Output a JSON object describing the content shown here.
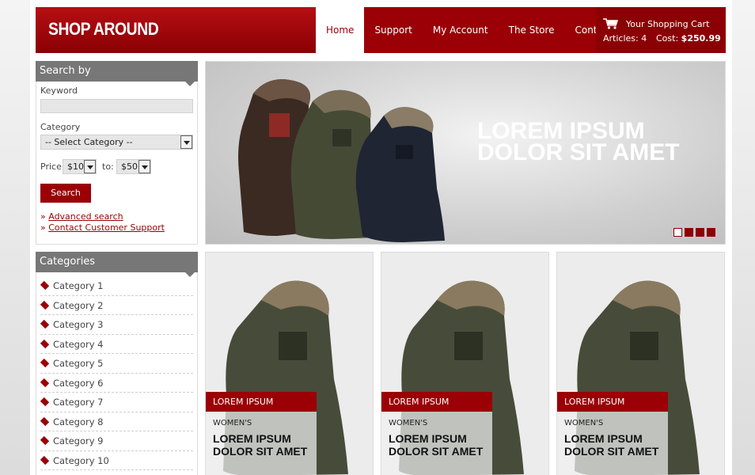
{
  "header": {
    "logo": "SHOP AROUND",
    "nav": [
      "Home",
      "Support",
      "My Account",
      "The Store",
      "Contact"
    ],
    "active_nav": "Home",
    "cart": {
      "title": "Your Shopping Cart",
      "articles_label": "Articles: 4",
      "cost_label": "Cost:",
      "cost_value": "$250.99"
    }
  },
  "search": {
    "heading": "Search by",
    "keyword_label": "Keyword",
    "keyword_value": "",
    "category_label": "Category",
    "category_value": "-- Select Category --",
    "price_label": "Price",
    "price_from": "$10",
    "to_label": "to:",
    "price_to": "$50",
    "button": "Search",
    "links": [
      "Advanced search",
      "Contact Customer Support"
    ]
  },
  "categories": {
    "heading": "Categories",
    "items": [
      "Category 1",
      "Category 2",
      "Category 3",
      "Category 4",
      "Category 5",
      "Category 6",
      "Category 7",
      "Category 8",
      "Category 9",
      "Category 10"
    ]
  },
  "slider": {
    "title": "LOREM IPSUM DOLOR SIT AMET",
    "slide_count": 4,
    "active_slide": 1
  },
  "products": [
    {
      "tag": "LOREM IPSUM",
      "category": "WOMEN'S",
      "name": "LOREM IPSUM DOLOR SIT AMET"
    },
    {
      "tag": "LOREM IPSUM",
      "category": "WOMEN'S",
      "name": "LOREM IPSUM DOLOR SIT AMET"
    },
    {
      "tag": "LOREM IPSUM",
      "category": "WOMEN'S",
      "name": "LOREM IPSUM DOLOR SIT AMET"
    }
  ],
  "colors": {
    "brand_red": "#9a0006",
    "panel_gray": "#777777"
  }
}
